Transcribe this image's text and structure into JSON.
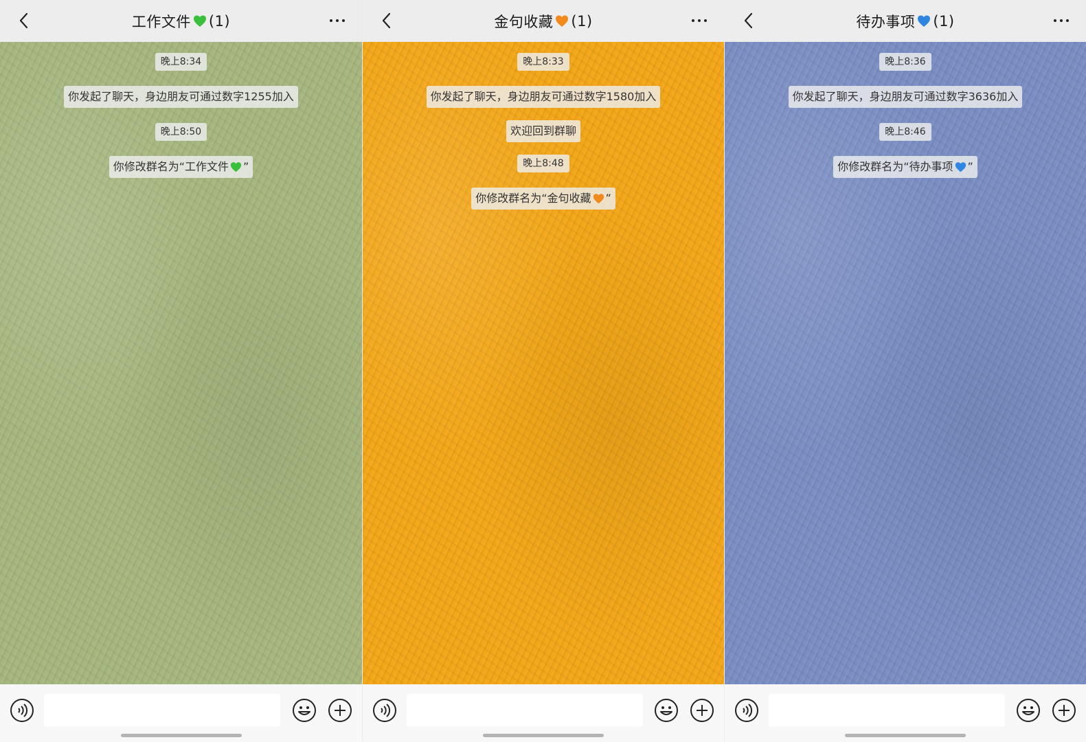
{
  "screens": [
    {
      "title": "工作文件",
      "heart_icon": "green-heart-icon",
      "heart_color": "#3cbf3c",
      "count": "(1)",
      "bg_color": "#a7b780",
      "messages": [
        {
          "type": "time",
          "text": "晚上8:34"
        },
        {
          "type": "system",
          "text": "你发起了聊天，身边朋友可通过数字1255加入"
        },
        {
          "type": "time",
          "text": "晚上8:50"
        },
        {
          "type": "system",
          "text": "你修改群名为“工作文件",
          "suffix": "”",
          "heart": true
        }
      ],
      "input_placeholder": ""
    },
    {
      "title": "金句收藏",
      "heart_icon": "orange-heart-icon",
      "heart_color": "#f08a1c",
      "count": "(1)",
      "bg_color": "#f4a718",
      "messages": [
        {
          "type": "time",
          "text": "晚上8:33"
        },
        {
          "type": "system",
          "text": "你发起了聊天，身边朋友可通过数字1580加入"
        },
        {
          "type": "system",
          "text": "欢迎回到群聊"
        },
        {
          "type": "time",
          "text": "晚上8:48"
        },
        {
          "type": "system",
          "text": "你修改群名为“金句收藏",
          "suffix": "”",
          "heart": true
        }
      ],
      "input_placeholder": ""
    },
    {
      "title": "待办事项",
      "heart_icon": "blue-heart-icon",
      "heart_color": "#2f86e0",
      "count": "(1)",
      "bg_color": "#7b8fc4",
      "messages": [
        {
          "type": "time",
          "text": "晚上8:36"
        },
        {
          "type": "system",
          "text": "你发起了聊天，身边朋友可通过数字3636加入"
        },
        {
          "type": "time",
          "text": "晚上8:46"
        },
        {
          "type": "system",
          "text": "你修改群名为“待办事项",
          "suffix": "”",
          "heart": true
        }
      ],
      "input_placeholder": ""
    }
  ],
  "icons": {
    "back": "back-arrow-icon",
    "more": "more-dots-icon",
    "voice": "voice-icon",
    "emoji": "emoji-icon",
    "plus": "plus-icon"
  }
}
